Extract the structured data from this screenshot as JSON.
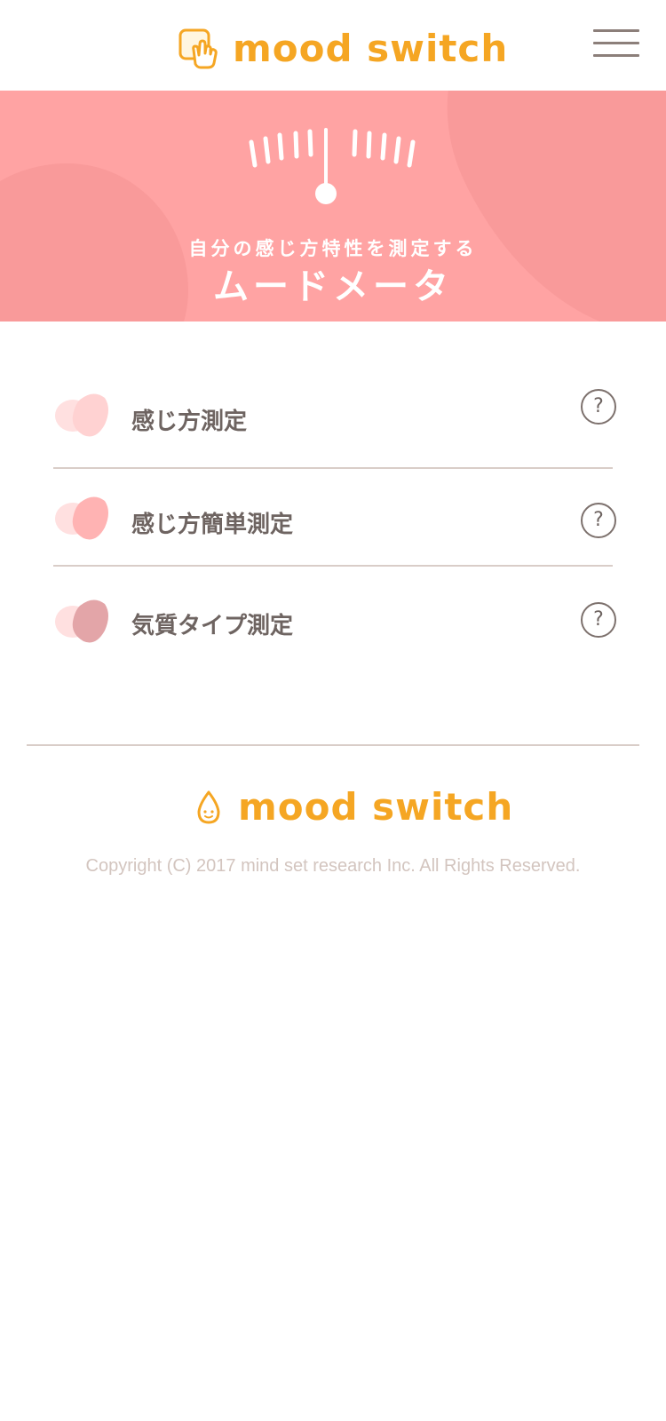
{
  "header": {
    "logo_text": "mood switch",
    "logo_icon": "hand-pointer-icon",
    "menu_icon": "hamburger-menu-icon"
  },
  "hero": {
    "icon": "gauge-meter-icon",
    "subtitle": "自分の感じ方特性を測定する",
    "title": "ムードメータ",
    "bg_color": "#ffa3a3"
  },
  "menu": {
    "items": [
      {
        "label": "感じ方測定",
        "icon": "blob-icon",
        "help": "?"
      },
      {
        "label": "感じ方簡単測定",
        "icon": "blob-icon",
        "help": "?"
      },
      {
        "label": "気質タイプ測定",
        "icon": "blob-icon",
        "help": "?"
      }
    ]
  },
  "footer": {
    "logo_text": "mood switch",
    "logo_icon": "droplet-smile-icon",
    "copyright": "Copyright (C) 2017 mind set research Inc. All Rights Reserved."
  },
  "colors": {
    "brand": "#f5a623",
    "hero": "#ffa3a3",
    "text": "#6e6461"
  }
}
